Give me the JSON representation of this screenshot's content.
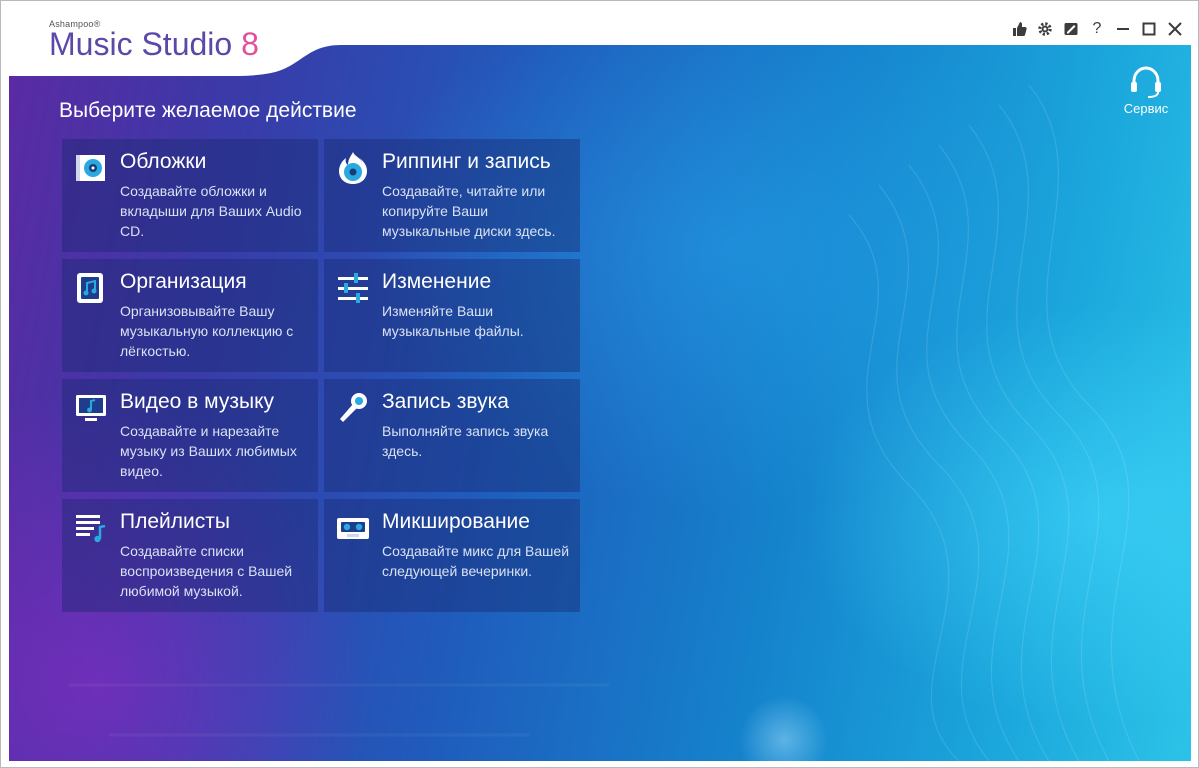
{
  "app": {
    "brand": "Ashampoo®",
    "product": "Music Studio",
    "version": "8"
  },
  "titlebar": {
    "icons": [
      "thumbs-up-icon",
      "gear-icon",
      "edit-icon",
      "help-icon",
      "minimize-icon",
      "maximize-icon",
      "close-icon"
    ],
    "help_label": "?"
  },
  "main": {
    "heading": "Выберите желаемое действие",
    "service_label": "Сервис",
    "tiles": [
      {
        "title": "Обложки",
        "desc": "Создавайте обложки и вкладыши для Ваших Audio CD.",
        "icon": "cover-icon"
      },
      {
        "title": "Риппинг и запись",
        "desc": "Создавайте, читайте или копируйте Ваши музыкальные диски здесь.",
        "icon": "disc-burn-icon"
      },
      {
        "title": "Организация",
        "desc": "Организовывайте Вашу музыкальную коллекцию с лёгкостью.",
        "icon": "music-note-icon"
      },
      {
        "title": "Изменение",
        "desc": "Изменяйте Ваши музыкальные файлы.",
        "icon": "sliders-icon"
      },
      {
        "title": "Видео в музыку",
        "desc": "Создавайте и нарезайте музыку из Ваших любимых видео.",
        "icon": "monitor-note-icon"
      },
      {
        "title": "Запись звука",
        "desc": "Выполняйте запись звука здесь.",
        "icon": "microphone-icon"
      },
      {
        "title": "Плейлисты",
        "desc": "Создавайте списки воспроизведения с Вашей любимой музыкой.",
        "icon": "playlist-icon"
      },
      {
        "title": "Микширование",
        "desc": "Создавайте микс для Вашей следующей вечеринки.",
        "icon": "cassette-icon"
      }
    ]
  },
  "colors": {
    "accent": "#5c48a8",
    "version_pink": "#e0509c",
    "icon_blue": "#2aa8e0"
  }
}
